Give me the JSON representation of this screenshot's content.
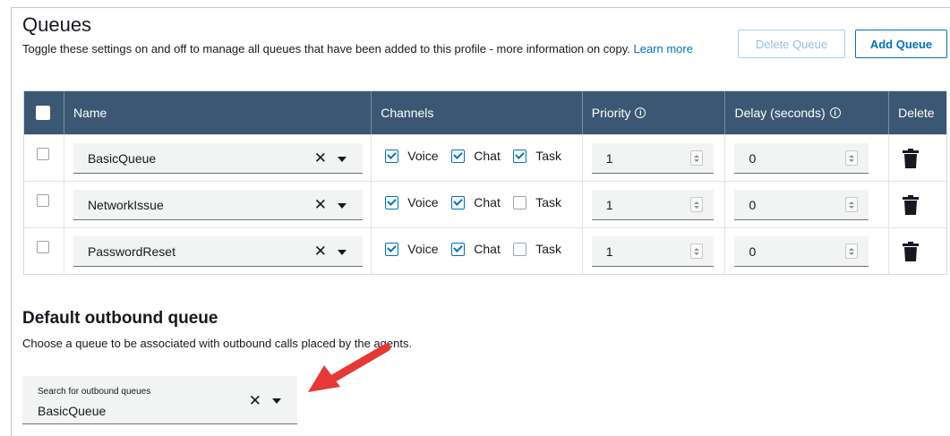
{
  "header": {
    "title": "Queues",
    "subtitle": "Toggle these settings on and off to manage all queues that have been added to this profile - more information on copy.",
    "learn_more": "Learn more",
    "delete_queue": "Delete Queue",
    "add_queue": "Add Queue"
  },
  "table": {
    "columns": {
      "name": "Name",
      "channels": "Channels",
      "priority": "Priority",
      "delay": "Delay (seconds)",
      "delete": "Delete"
    },
    "channel_labels": {
      "voice": "Voice",
      "chat": "Chat",
      "task": "Task"
    },
    "rows": [
      {
        "name": "BasicQueue",
        "voice": true,
        "chat": true,
        "task": true,
        "priority": "1",
        "delay": "0"
      },
      {
        "name": "NetworkIssue",
        "voice": true,
        "chat": true,
        "task": false,
        "priority": "1",
        "delay": "0"
      },
      {
        "name": "PasswordReset",
        "voice": true,
        "chat": true,
        "task": false,
        "priority": "1",
        "delay": "0"
      }
    ]
  },
  "outbound": {
    "title": "Default outbound queue",
    "description": "Choose a queue to be associated with outbound calls placed by the agents.",
    "search_label": "Search for outbound queues",
    "value": "BasicQueue"
  },
  "colors": {
    "header_bg": "#3c5773",
    "link": "#0073bb",
    "annotation_arrow": "#e53935"
  },
  "icons": [
    "clear-icon",
    "caret-down-icon",
    "info-icon",
    "trash-icon",
    "checkbox-icon",
    "spinner-icon",
    "annotation-arrow"
  ]
}
